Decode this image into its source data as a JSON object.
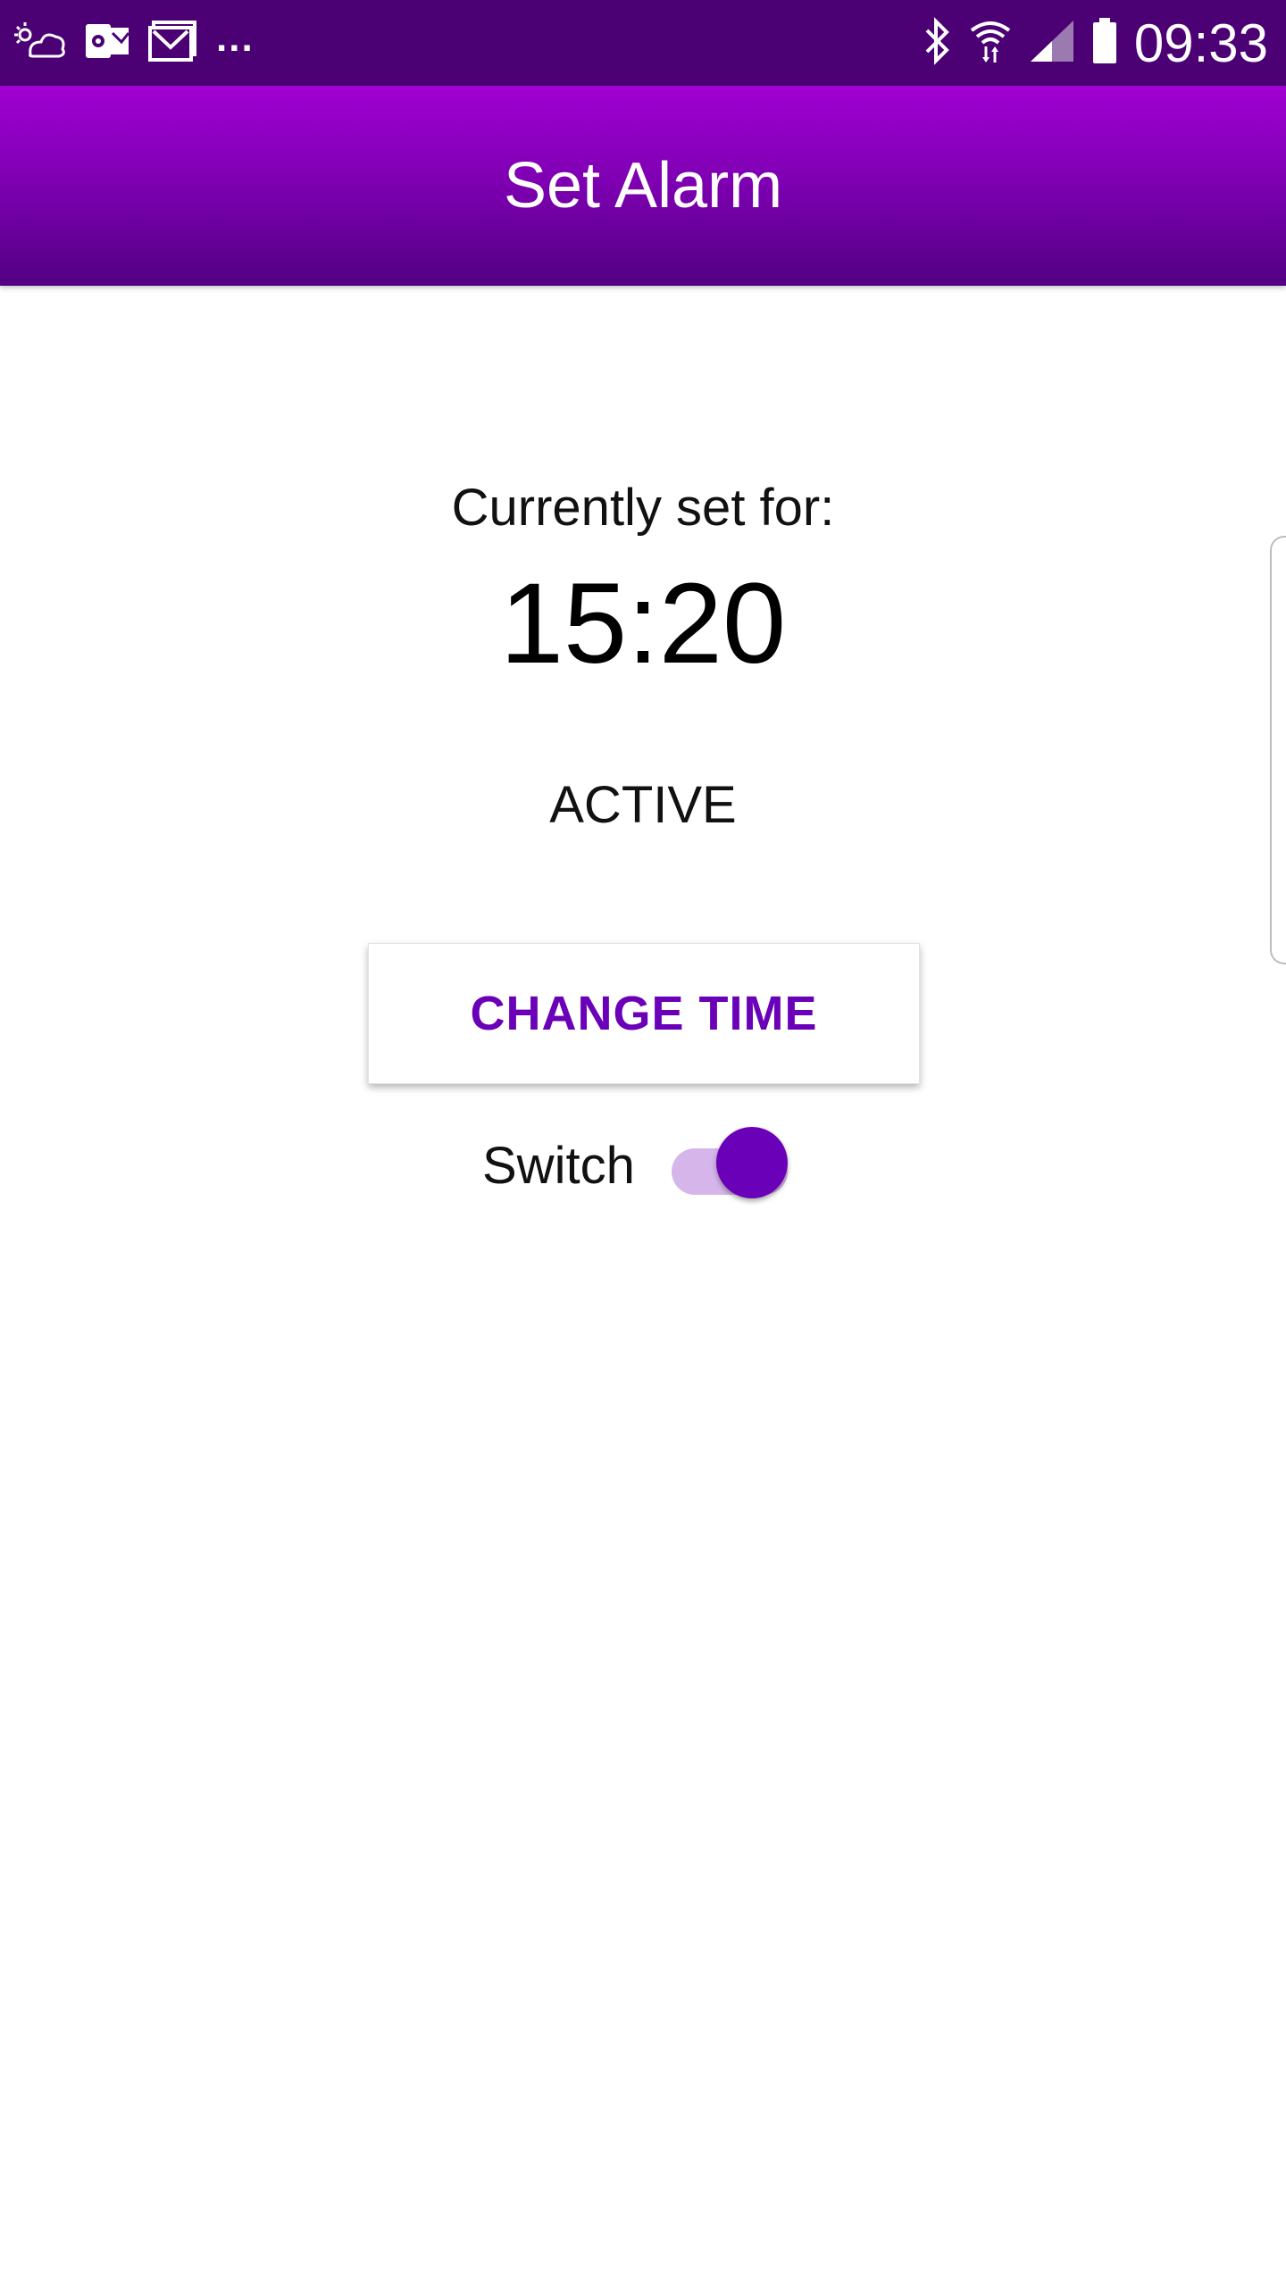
{
  "status_bar": {
    "left_icons": [
      "cloud-sun-icon",
      "outlook-icon",
      "gmail-icon"
    ],
    "more": "...",
    "right_icons": [
      "bluetooth-icon",
      "wifi-icon",
      "signal-icon",
      "battery-icon"
    ],
    "time": "09:33"
  },
  "app_bar": {
    "title": "Set Alarm"
  },
  "main": {
    "label": "Currently set for:",
    "time": "15:20",
    "status": "ACTIVE",
    "change_button": "CHANGE TIME",
    "switch_label": "Switch",
    "switch_on": true
  },
  "colors": {
    "status_bar": "#4b0074",
    "app_bar_top": "#a000d2",
    "app_bar_bottom": "#520083",
    "accent": "#6a00b8",
    "switch_track": "#d6b6ea"
  }
}
